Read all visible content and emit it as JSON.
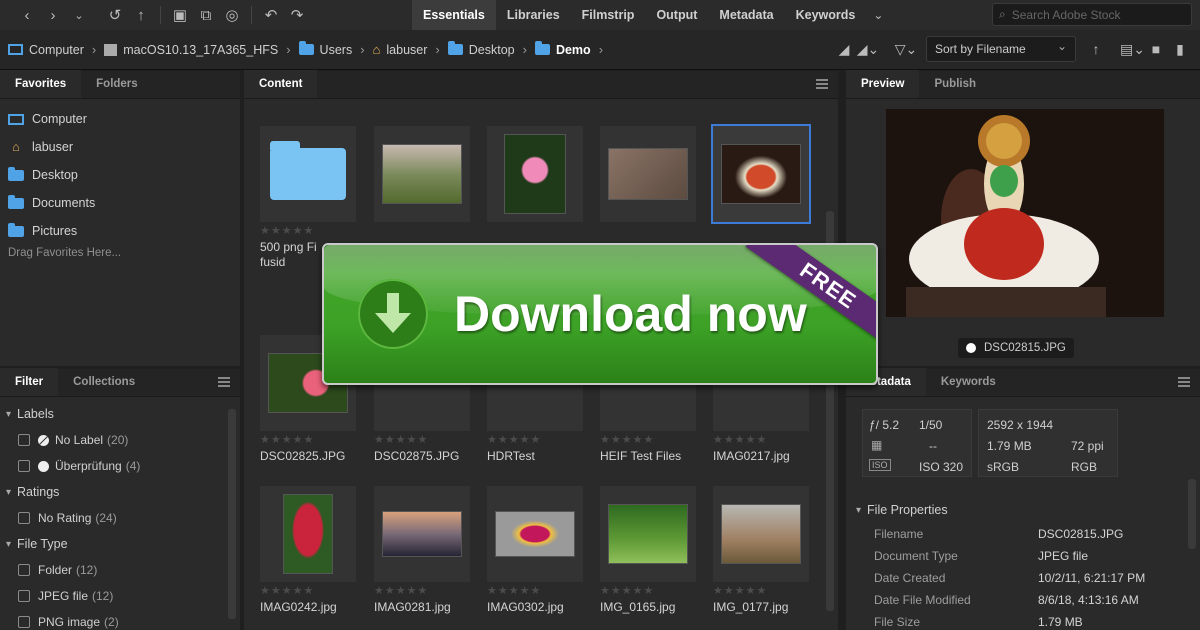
{
  "toolbar": {
    "icons": [
      "chevron-left-icon",
      "chevron-right-icon",
      "chevron-down-icon",
      "history-icon",
      "boomerang-icon",
      "camera-icon",
      "copy-icon",
      "refine-icon",
      "rotate-left-icon",
      "rotate-right-icon"
    ],
    "workspaces": [
      "Essentials",
      "Libraries",
      "Filmstrip",
      "Output",
      "Metadata",
      "Keywords"
    ],
    "active_workspace": "Essentials",
    "more_glyph": "⌄",
    "search_placeholder": "Search Adobe Stock"
  },
  "path": {
    "crumbs": [
      {
        "label": "Computer",
        "icon": "monitor-icon"
      },
      {
        "label": "macOS10.13_17A365_HFS",
        "icon": "drive-icon"
      },
      {
        "label": "Users",
        "icon": "folder-icon"
      },
      {
        "label": "labuser",
        "icon": "home-icon"
      },
      {
        "label": "Desktop",
        "icon": "folder-icon"
      },
      {
        "label": "Demo",
        "icon": "folder-icon"
      }
    ],
    "sort_label": "Sort by Filename"
  },
  "favorites": {
    "tabs": [
      "Favorites",
      "Folders"
    ],
    "items": [
      {
        "label": "Computer",
        "icon": "monitor-icon"
      },
      {
        "label": "labuser",
        "icon": "home-icon"
      },
      {
        "label": "Desktop",
        "icon": "folder-icon"
      },
      {
        "label": "Documents",
        "icon": "folder-icon"
      },
      {
        "label": "Pictures",
        "icon": "folder-icon"
      }
    ],
    "drag_hint": "Drag Favorites Here..."
  },
  "filter": {
    "tabs": [
      "Filter",
      "Collections"
    ],
    "groups": [
      {
        "label": "Labels",
        "items": [
          {
            "label": "No Label",
            "count": "(20)"
          },
          {
            "label": "Überprüfung",
            "count": "(4)"
          }
        ]
      },
      {
        "label": "Ratings",
        "items": [
          {
            "label": "No Rating",
            "count": "(24)"
          }
        ]
      },
      {
        "label": "File Type",
        "items": [
          {
            "label": "Folder",
            "count": "(12)"
          },
          {
            "label": "JPEG file",
            "count": "(12)"
          },
          {
            "label": "PNG image",
            "count": "(2)"
          }
        ]
      }
    ]
  },
  "content": {
    "tab": "Content",
    "stars": "★★★★★",
    "row1_names": [
      "500 png Fi",
      "fusid"
    ],
    "row2_names": [
      "DSC02825.JPG",
      "DSC02875.JPG",
      "HDRTest",
      "HEIF Test Files",
      "IMAG0217.jpg"
    ],
    "row3_names": [
      "IMAG0242.jpg",
      "IMAG0281.jpg",
      "IMAG0302.jpg",
      "IMG_0165.jpg",
      "IMG_0177.jpg"
    ]
  },
  "preview": {
    "tabs": [
      "Preview",
      "Publish"
    ],
    "filename": "DSC02815.JPG"
  },
  "metadata": {
    "tabs": [
      "Metadata",
      "Keywords"
    ],
    "exif": {
      "aperture": "ƒ/ 5.2",
      "shutter": "1/50",
      "metering": "--",
      "iso": "ISO 320"
    },
    "dims": {
      "pixels": "2592 x 1944",
      "size": "1.79 MB",
      "ppi": "72 ppi",
      "color": "sRGB",
      "mode": "RGB"
    },
    "section": "File Properties",
    "properties": [
      {
        "key": "Filename",
        "value": "DSC02815.JPG"
      },
      {
        "key": "Document Type",
        "value": "JPEG file"
      },
      {
        "key": "Date Created",
        "value": "10/2/11, 6:21:17 PM"
      },
      {
        "key": "Date File Modified",
        "value": "8/6/18, 4:13:16 AM"
      },
      {
        "key": "File Size",
        "value": "1.79 MB"
      }
    ]
  },
  "download_overlay": {
    "text": "Download now",
    "ribbon": "FREE",
    "color": "#3ca126"
  }
}
